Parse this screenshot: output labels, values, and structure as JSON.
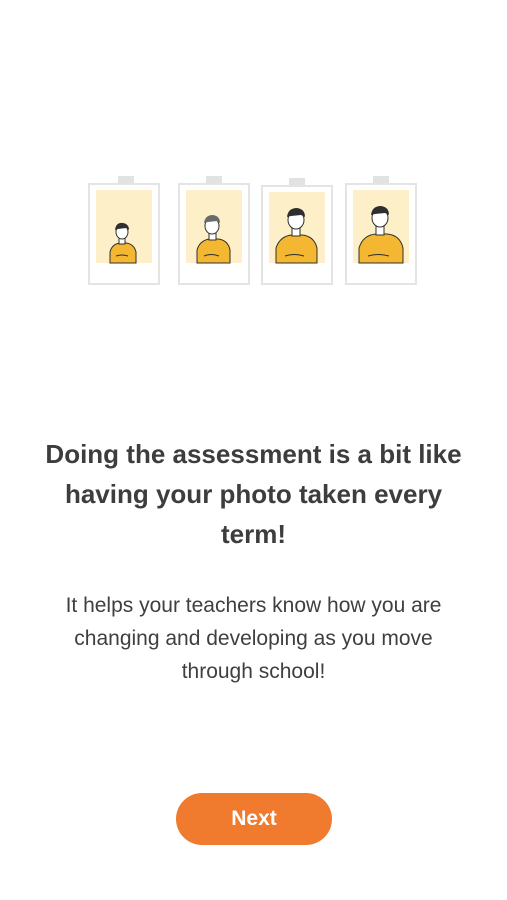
{
  "illustration": {
    "frames": [
      {
        "icon": "child-photo-icon",
        "stage": 1
      },
      {
        "icon": "child-photo-icon",
        "stage": 2
      },
      {
        "icon": "child-photo-icon",
        "stage": 3
      },
      {
        "icon": "child-photo-icon",
        "stage": 4
      }
    ],
    "colors": {
      "frame_border": "#e4e4e4",
      "photo_background": "#fdefc7",
      "tape": "#e2e2e2",
      "shirt": "#f4b731",
      "hair": "#2f2f2f"
    }
  },
  "content": {
    "headline": "Doing the assessment is a bit like having your photo taken every term!",
    "subtext": "It  helps your teachers know how you are changing and developing as you move through school!"
  },
  "actions": {
    "next_label": "Next"
  },
  "colors": {
    "accent": "#f07a2e",
    "text": "#3d3d3d"
  }
}
